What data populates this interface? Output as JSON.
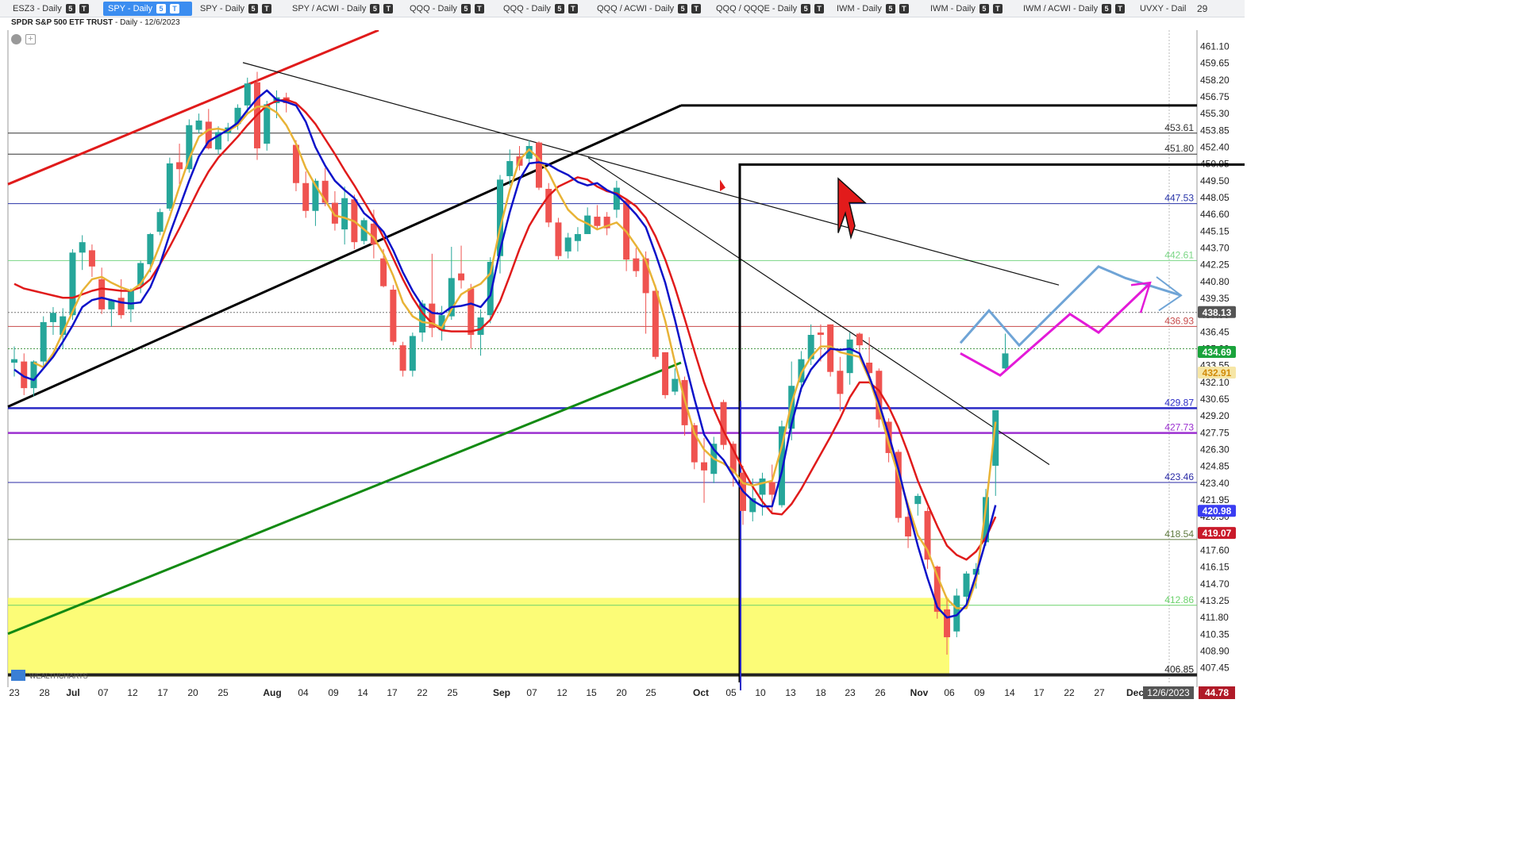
{
  "tabs": [
    {
      "label": "ESZ3 - Daily",
      "badges": [
        "5",
        "T"
      ],
      "active": false
    },
    {
      "label": "SPY - Daily",
      "badges": [
        "5",
        "T"
      ],
      "active": true
    },
    {
      "label": "SPY - Daily",
      "badges": [
        "5",
        "T"
      ],
      "active": false
    },
    {
      "label": "SPY / ACWI - Daily",
      "badges": [
        "5",
        "T"
      ],
      "active": false
    },
    {
      "label": "QQQ - Daily",
      "badges": [
        "5",
        "T"
      ],
      "active": false
    },
    {
      "label": "QQQ - Daily",
      "badges": [
        "5",
        "T"
      ],
      "active": false
    },
    {
      "label": "QQQ / ACWI - Daily",
      "badges": [
        "5",
        "T"
      ],
      "active": false
    },
    {
      "label": "QQQ / QQQE - Daily",
      "badges": [
        "5",
        "T"
      ],
      "active": false
    },
    {
      "label": "IWM - Daily",
      "badges": [
        "5",
        "T"
      ],
      "active": false
    },
    {
      "label": "IWM - Daily",
      "badges": [
        "5",
        "T"
      ],
      "active": false
    },
    {
      "label": "IWM / ACWI - Daily",
      "badges": [
        "5",
        "T"
      ],
      "active": false
    },
    {
      "label": "UVXY - Dail",
      "badges": [],
      "active": false
    }
  ],
  "tab_count": "29",
  "chart_header": {
    "symbol_name": "SPDR S&P 500 ETF TRUST",
    "interval": "- Daily - 12/6/2023"
  },
  "logo_text": "WEALTHCHARTS",
  "colors": {
    "up": "#26a69a",
    "down": "#ef5350",
    "sma_fast": "#0d12c9",
    "sma_mid": "#e8b336",
    "sma_slow": "#e01b1b",
    "grid": "#e6e6e6",
    "highlight": "#fcfc5f"
  },
  "chart_data": {
    "type": "candlestick",
    "y_range": [
      406.2,
      462.5
    ],
    "y_ticks": [
      "461.10",
      "459.65",
      "458.20",
      "456.75",
      "455.30",
      "453.85",
      "452.40",
      "450.95",
      "449.50",
      "448.05",
      "446.60",
      "445.15",
      "443.70",
      "442.25",
      "440.80",
      "439.35",
      "437.90",
      "436.45",
      "435.00",
      "433.55",
      "432.10",
      "430.65",
      "429.20",
      "427.75",
      "426.30",
      "424.85",
      "423.40",
      "421.95",
      "420.50",
      "419.05",
      "417.60",
      "416.15",
      "414.70",
      "413.25",
      "411.80",
      "410.35",
      "408.90",
      "407.45"
    ],
    "x_labels": [
      "23",
      "28",
      "Jul",
      "07",
      "12",
      "17",
      "20",
      "25",
      "Aug",
      "04",
      "09",
      "14",
      "17",
      "22",
      "25",
      "Sep",
      "07",
      "12",
      "15",
      "20",
      "25",
      "Oct",
      "05",
      "10",
      "13",
      "18",
      "23",
      "26",
      "Nov",
      "06",
      "09",
      "14",
      "17",
      "22",
      "27",
      "Dec"
    ],
    "date_badge": "12/6/2023",
    "x_badge": "44.78",
    "candles": [
      [
        433.8,
        435.2,
        432.6,
        434.1
      ],
      [
        433.9,
        434.6,
        431.0,
        431.6
      ],
      [
        431.6,
        434.0,
        430.9,
        433.9
      ],
      [
        433.9,
        437.8,
        433.4,
        437.3
      ],
      [
        437.3,
        438.6,
        436.2,
        438.1
      ],
      [
        436.2,
        438.5,
        435.0,
        437.8
      ],
      [
        437.9,
        443.6,
        437.5,
        443.3
      ],
      [
        443.3,
        444.8,
        441.8,
        444.2
      ],
      [
        443.5,
        444.0,
        441.2,
        442.1
      ],
      [
        441.0,
        442.0,
        438.0,
        438.4
      ],
      [
        438.4,
        439.3,
        436.9,
        439.2
      ],
      [
        439.4,
        441.0,
        437.6,
        437.9
      ],
      [
        438.4,
        440.2,
        437.3,
        440.0
      ],
      [
        440.5,
        442.6,
        439.8,
        442.4
      ],
      [
        442.3,
        445.0,
        441.6,
        444.9
      ],
      [
        445.1,
        447.1,
        444.8,
        446.8
      ],
      [
        447.1,
        451.5,
        446.9,
        451.0
      ],
      [
        451.1,
        452.7,
        449.2,
        450.5
      ],
      [
        450.5,
        454.8,
        450.2,
        454.3
      ],
      [
        453.9,
        455.3,
        453.6,
        454.7
      ],
      [
        454.6,
        455.7,
        452.2,
        452.3
      ],
      [
        452.2,
        454.2,
        451.8,
        453.7
      ],
      [
        453.6,
        454.5,
        452.9,
        454.1
      ],
      [
        454.4,
        456.1,
        453.9,
        455.8
      ],
      [
        456.0,
        458.4,
        455.4,
        457.9
      ],
      [
        458.0,
        458.9,
        451.3,
        452.3
      ],
      [
        452.7,
        456.4,
        452.1,
        456.1
      ],
      [
        456.2,
        457.3,
        454.9,
        456.7
      ],
      [
        456.7,
        457.1,
        455.4,
        456.2
      ],
      [
        452.6,
        453.0,
        448.6,
        449.3
      ],
      [
        449.3,
        450.3,
        446.3,
        446.9
      ],
      [
        446.9,
        449.7,
        445.6,
        449.5
      ],
      [
        449.5,
        450.6,
        447.3,
        447.6
      ],
      [
        447.6,
        448.6,
        445.2,
        445.8
      ],
      [
        445.3,
        449.0,
        444.0,
        448.0
      ],
      [
        447.9,
        448.3,
        443.6,
        444.2
      ],
      [
        444.3,
        446.3,
        444.0,
        446.1
      ],
      [
        445.8,
        447.0,
        442.8,
        444.0
      ],
      [
        442.8,
        443.6,
        440.3,
        440.4
      ],
      [
        440.1,
        440.5,
        435.3,
        435.6
      ],
      [
        435.3,
        435.6,
        432.6,
        433.1
      ],
      [
        433.1,
        436.4,
        432.6,
        436.1
      ],
      [
        436.4,
        439.2,
        435.6,
        438.9
      ],
      [
        438.9,
        443.2,
        436.0,
        436.8
      ],
      [
        436.6,
        438.7,
        435.7,
        437.9
      ],
      [
        437.8,
        443.8,
        437.5,
        441.1
      ],
      [
        441.5,
        443.9,
        440.2,
        440.9
      ],
      [
        440.2,
        440.6,
        435.0,
        436.2
      ],
      [
        436.2,
        438.4,
        434.4,
        437.7
      ],
      [
        437.9,
        442.9,
        437.2,
        442.5
      ],
      [
        443.0,
        450.0,
        441.5,
        449.6
      ],
      [
        449.9,
        452.2,
        449.1,
        451.2
      ],
      [
        451.6,
        452.5,
        450.4,
        450.8
      ],
      [
        451.4,
        453.0,
        451.1,
        452.5
      ],
      [
        452.8,
        452.9,
        448.7,
        448.9
      ],
      [
        448.8,
        449.3,
        445.5,
        445.9
      ],
      [
        445.9,
        446.3,
        442.7,
        443.0
      ],
      [
        443.4,
        445.0,
        442.8,
        444.6
      ],
      [
        444.3,
        445.5,
        443.4,
        444.9
      ],
      [
        444.9,
        447.2,
        444.9,
        446.5
      ],
      [
        446.4,
        447.4,
        445.4,
        445.6
      ],
      [
        446.4,
        446.8,
        444.8,
        445.4
      ],
      [
        447.0,
        449.5,
        446.3,
        448.9
      ],
      [
        447.8,
        447.8,
        441.7,
        442.7
      ],
      [
        442.8,
        443.7,
        441.2,
        441.7
      ],
      [
        442.8,
        443.4,
        436.3,
        439.8
      ],
      [
        440.0,
        440.5,
        434.1,
        434.3
      ],
      [
        434.7,
        434.7,
        430.7,
        431.0
      ],
      [
        431.3,
        433.3,
        431.0,
        432.4
      ],
      [
        432.3,
        432.6,
        427.5,
        428.4
      ],
      [
        428.4,
        428.6,
        424.6,
        425.2
      ],
      [
        425.2,
        427.3,
        421.7,
        424.5
      ],
      [
        424.2,
        427.4,
        423.4,
        426.8
      ],
      [
        430.4,
        430.6,
        426.3,
        426.7
      ],
      [
        426.8,
        427.0,
        423.1,
        424.3
      ],
      [
        424.3,
        424.9,
        419.8,
        421.0
      ],
      [
        420.9,
        423.8,
        420.1,
        422.1
      ],
      [
        422.4,
        424.3,
        420.6,
        423.8
      ],
      [
        423.5,
        425.0,
        420.8,
        422.4
      ],
      [
        421.5,
        428.8,
        421.3,
        428.3
      ],
      [
        428.1,
        433.9,
        427.1,
        431.8
      ],
      [
        432.1,
        434.8,
        431.3,
        434.1
      ],
      [
        434.1,
        437.1,
        433.6,
        436.2
      ],
      [
        436.4,
        437.1,
        433.9,
        436.2
      ],
      [
        437.1,
        437.1,
        432.6,
        433.0
      ],
      [
        433.1,
        434.3,
        429.6,
        431.1
      ],
      [
        432.9,
        436.4,
        431.9,
        435.8
      ],
      [
        436.3,
        436.4,
        434.2,
        435.3
      ],
      [
        433.8,
        436.0,
        432.7,
        432.9
      ],
      [
        433.1,
        433.3,
        428.2,
        428.9
      ],
      [
        428.7,
        429.0,
        425.2,
        426.0
      ],
      [
        426.1,
        426.3,
        420.0,
        420.4
      ],
      [
        420.5,
        421.7,
        417.8,
        418.8
      ],
      [
        421.6,
        422.5,
        420.6,
        422.3
      ],
      [
        421.0,
        421.3,
        416.0,
        416.8
      ],
      [
        416.2,
        416.3,
        411.7,
        412.3
      ],
      [
        412.5,
        413.6,
        408.6,
        410.1
      ],
      [
        410.6,
        414.3,
        410.1,
        413.7
      ],
      [
        413.6,
        415.8,
        412.9,
        415.6
      ],
      [
        415.5,
        416.5,
        414.3,
        416.0
      ],
      [
        418.3,
        422.9,
        418.0,
        422.2
      ],
      [
        424.9,
        428.4,
        422.3,
        429.7
      ],
      [
        433.3,
        436.3,
        433.1,
        434.6
      ]
    ],
    "sma_fast": [
      433.2,
      432.6,
      432.3,
      433.3,
      434.3,
      435.6,
      437.0,
      438.6,
      439.2,
      439.4,
      439.2,
      439.0,
      438.9,
      439.0,
      440.3,
      442.3,
      444.9,
      447.2,
      449.5,
      451.6,
      452.9,
      453.4,
      453.9,
      454.5,
      455.6,
      456.6,
      457.3,
      456.5,
      456.3,
      456.0,
      454.6,
      452.4,
      450.8,
      449.5,
      448.7,
      448.0,
      446.7,
      446.0,
      445.1,
      443.5,
      441.6,
      440.0,
      438.7,
      438.1,
      438.0,
      438.6,
      438.7,
      438.9,
      438.6,
      439.6,
      443.5,
      446.8,
      449.6,
      451.0,
      451.1,
      450.9,
      450.4,
      450.0,
      449.4,
      449.1,
      449.3,
      448.7,
      448.3,
      447.5,
      446.6,
      445.5,
      443.2,
      440.7,
      437.5,
      434.0,
      430.7,
      427.6,
      426.3,
      425.4,
      424.0,
      422.7,
      421.9,
      421.4,
      421.4,
      424.4,
      428.5,
      431.6,
      433.2,
      434.2,
      435.0,
      434.9,
      435.0,
      434.6,
      432.6,
      430.3,
      427.6,
      424.6,
      421.2,
      418.0,
      415.2,
      412.7,
      411.8,
      412.0,
      412.9,
      415.5,
      418.4,
      421.5
    ],
    "sma_mid": [
      null,
      null,
      433.8,
      433.4,
      434.6,
      436.4,
      438.2,
      440.0,
      441.0,
      441.2,
      440.7,
      440.3,
      440.0,
      440.6,
      441.9,
      444.0,
      446.4,
      449.0,
      451.4,
      453.3,
      453.9,
      454.0,
      453.8,
      454.3,
      455.3,
      455.9,
      455.9,
      455.4,
      454.3,
      452.7,
      450.6,
      449.1,
      447.8,
      446.5,
      446.3,
      446.0,
      445.3,
      444.6,
      443.2,
      441.3,
      439.0,
      437.8,
      437.3,
      437.2,
      436.8,
      438.4,
      439.7,
      440.2,
      440.6,
      441.5,
      445.4,
      448.7,
      451.3,
      452.2,
      451.4,
      450.2,
      448.5,
      447.0,
      446.2,
      445.8,
      445.3,
      445.6,
      445.9,
      445.1,
      443.9,
      442.6,
      440.3,
      437.4,
      433.8,
      430.6,
      427.7,
      426.3,
      425.5,
      425.1,
      424.5,
      423.4,
      423.2,
      423.4,
      423.6,
      426.6,
      430.3,
      432.9,
      434.3,
      435.2,
      435.2,
      434.7,
      434.5,
      434.3,
      432.4,
      429.9,
      426.8,
      424.1,
      421.5,
      418.9,
      417.6,
      415.4,
      413.4,
      412.6,
      412.6,
      415.0,
      421.3,
      428.7
    ],
    "sma_slow": [
      440.6,
      440.2,
      440.0,
      439.8,
      439.6,
      439.4,
      439.4,
      439.7,
      440.0,
      440.2,
      440.1,
      440.0,
      440.0,
      440.3,
      441.0,
      442.3,
      443.8,
      445.4,
      447.1,
      448.8,
      450.3,
      451.5,
      452.4,
      453.3,
      454.3,
      455.2,
      456.0,
      456.4,
      456.5,
      456.2,
      455.4,
      454.4,
      453.1,
      451.8,
      450.4,
      449.1,
      447.7,
      446.3,
      444.6,
      442.8,
      441.0,
      439.4,
      438.1,
      437.2,
      436.6,
      436.5,
      436.5,
      436.5,
      436.7,
      437.5,
      439.1,
      441.3,
      443.6,
      445.6,
      447.0,
      448.2,
      449.0,
      449.4,
      449.8,
      449.6,
      449.0,
      448.6,
      448.4,
      447.9,
      447.3,
      446.3,
      444.7,
      442.7,
      440.3,
      437.6,
      434.8,
      432.1,
      429.8,
      427.9,
      426.3,
      424.6,
      423.1,
      421.8,
      420.8,
      420.7,
      421.6,
      422.9,
      424.4,
      425.9,
      427.4,
      429.0,
      430.8,
      432.1,
      432.1,
      431.4,
      430.0,
      428.2,
      426.0,
      423.6,
      421.6,
      419.7,
      418.0,
      417.2,
      416.8,
      417.5,
      418.7,
      420.5
    ],
    "price_tags": [
      {
        "value": "438.13",
        "bg": "#555555",
        "fg": "#ffffff",
        "label": true
      },
      {
        "value": "434.69",
        "bg": "#1aa33c",
        "fg": "#ffffff",
        "label": true
      },
      {
        "value": "432.91",
        "bg": "#f6e6a6",
        "fg": "#d18a08",
        "label": true
      },
      {
        "value": "420.98",
        "bg": "#3a3df2",
        "fg": "#ffffff",
        "label": true
      },
      {
        "value": "419.07",
        "bg": "#c91a2a",
        "fg": "#ffffff",
        "label": true
      }
    ],
    "levels": [
      {
        "value": "453.61",
        "color": "#333333"
      },
      {
        "value": "451.80",
        "color": "#333333"
      },
      {
        "value": "447.53",
        "color": "#2733a8"
      },
      {
        "value": "442.61",
        "color": "#7ad685"
      },
      {
        "value": "436.93",
        "color": "#c74a4a"
      },
      {
        "value": "429.87",
        "color": "#2a2ac6"
      },
      {
        "value": "427.73",
        "color": "#9b2fd0"
      },
      {
        "value": "423.46",
        "color": "#2a2aa6"
      },
      {
        "value": "418.54",
        "color": "#5f7a3f"
      },
      {
        "value": "412.86",
        "color": "#6bd26b"
      },
      {
        "value": "406.85",
        "color": "#222222"
      }
    ]
  }
}
